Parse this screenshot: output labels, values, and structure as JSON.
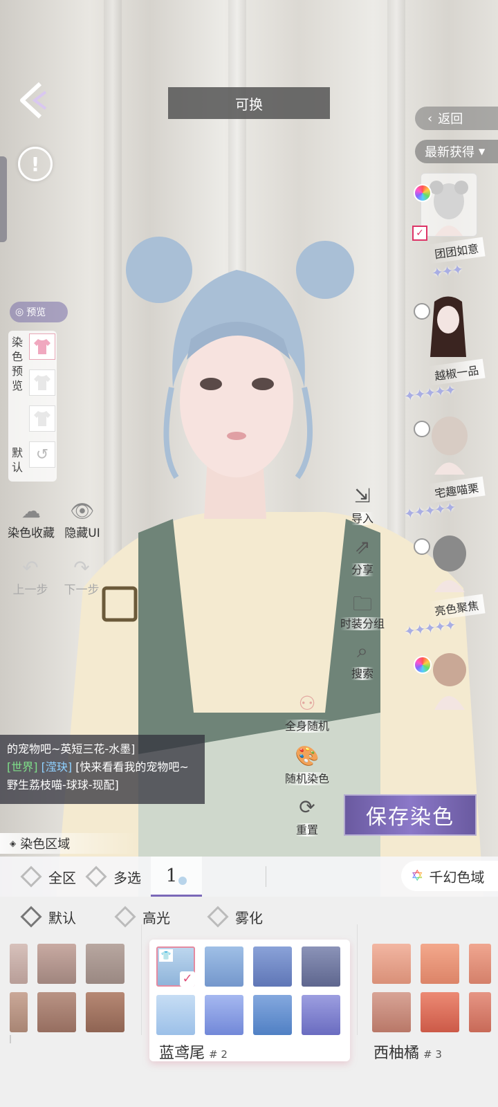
{
  "header": {
    "title": "可换"
  },
  "right_nav": {
    "return_label": "返回",
    "sort_label": "最新获得"
  },
  "hair_list": [
    {
      "name": "团团如意",
      "stars": "✦✦✦"
    },
    {
      "name": "越椒一品",
      "stars": "✦✦✦✦✦"
    },
    {
      "name": "宅趣喵栗",
      "stars": "✦✦✦✦✦"
    },
    {
      "name": "亮色聚焦",
      "stars": "✦✦✦✦✦"
    },
    {
      "name": ""
    }
  ],
  "left_panel": {
    "preview_label": "预览",
    "dye_preview_label": "染色预览",
    "default_label": "默认",
    "collect_label": "染色收藏",
    "hide_ui_label": "隐藏UI",
    "undo_label": "上一步",
    "redo_label": "下一步"
  },
  "center_tools": {
    "import": "导入",
    "share": "分享",
    "group": "时装分组",
    "search": "搜索",
    "random_all": "全身随机",
    "random_dye": "随机染色",
    "reset": "重置"
  },
  "chat": {
    "line1": "的宠物吧~英短三花-水墨]",
    "channel": "[世界]",
    "user": "[滢玦]",
    "message": "[快来看看我的宠物吧~野生荔枝喵-球球-现配]"
  },
  "save_label": "保存染色",
  "dye_region": {
    "title": "染色区域",
    "tab_all": "全区",
    "tab_multi": "多选",
    "tab_number": "1",
    "special": "千幻色域"
  },
  "sub_tabs": {
    "default": "默认",
    "highlight": "高光",
    "fog": "雾化"
  },
  "color_groups": [
    {
      "name": "蓝鸢尾",
      "index": "# 2"
    },
    {
      "name": "西柚橘",
      "index": "# 3"
    }
  ],
  "colors": {
    "accent": "#7a68b8",
    "hair": "#a9bfd6",
    "sweater": "#f4ead0",
    "overall": "#6f8478"
  }
}
